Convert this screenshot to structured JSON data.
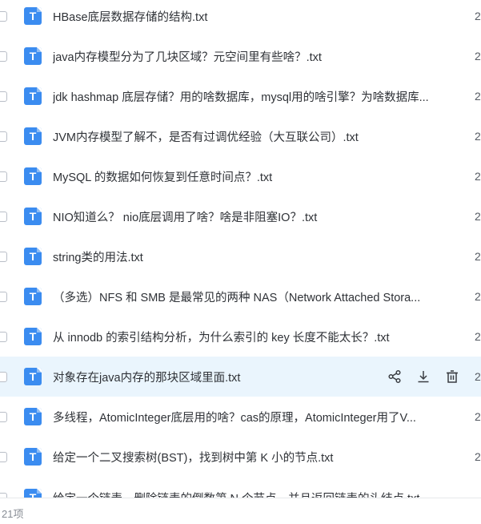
{
  "files": [
    {
      "name": "HBase底层数据存储的结构.txt",
      "trail": "2"
    },
    {
      "name": "java内存模型分为了几块区域？元空间里有些啥？.txt",
      "trail": "2"
    },
    {
      "name": "jdk hashmap 底层存储？用的啥数据库，mysql用的啥引擎？为啥数据库...",
      "trail": "2"
    },
    {
      "name": "JVM内存模型了解不，是否有过调优经验（大互联公司）.txt",
      "trail": "2"
    },
    {
      "name": "MySQL 的数据如何恢复到任意时间点？.txt",
      "trail": "2"
    },
    {
      "name": "NIO知道么？ nio底层调用了啥？啥是非阻塞IO？.txt",
      "trail": "2"
    },
    {
      "name": "string类的用法.txt",
      "trail": "2"
    },
    {
      "name": "（多选）NFS 和 SMB 是最常见的两种 NAS（Network Attached Stora...",
      "trail": "2"
    },
    {
      "name": "从 innodb 的索引结构分析，为什么索引的 key 长度不能太长？.txt",
      "trail": "2"
    },
    {
      "name": "对象存在java内存的那块区域里面.txt",
      "trail": "2"
    },
    {
      "name": "多线程，AtomicInteger底层用的啥？cas的原理，AtomicInteger用了V...",
      "trail": "2"
    },
    {
      "name": "给定一个二叉搜索树(BST)，找到树中第 K 小的节点.txt",
      "trail": "2"
    },
    {
      "name": "给定一个链表，删除链表的倒数第 N 个节点，并且返回链表的头结点.txt",
      "trail": ""
    }
  ],
  "file_icon_letter": "T",
  "highlight_index": 9,
  "colors": {
    "accent": "#3b8cf0",
    "highlight_bg": "#eaf5fd"
  },
  "icons": {
    "share": "share-icon",
    "download": "download-icon",
    "delete": "trash-icon"
  },
  "footer": {
    "count_label": "21项"
  }
}
